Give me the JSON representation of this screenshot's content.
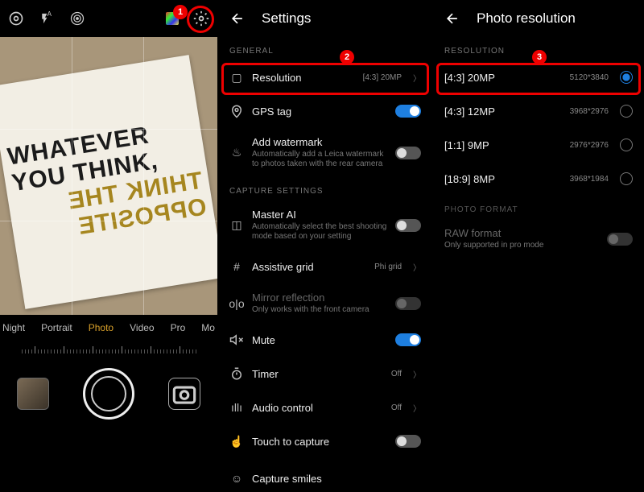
{
  "panel1": {
    "modes": [
      "Night",
      "Portrait",
      "Photo",
      "Video",
      "Pro",
      "Mo"
    ],
    "active_mode_index": 2,
    "poster_lines": [
      "WHATEVER",
      "YOU THINK,",
      "THINK THE",
      "OPPOSITE"
    ]
  },
  "panel2": {
    "title": "Settings",
    "sections": {
      "general": {
        "label": "GENERAL",
        "resolution": {
          "label": "Resolution",
          "value": "[4:3] 20MP"
        },
        "gps": {
          "label": "GPS tag",
          "on": true
        },
        "watermark": {
          "label": "Add watermark",
          "sub": "Automatically add a Leica watermark to photos taken with the rear camera",
          "on": false
        }
      },
      "capture": {
        "label": "CAPTURE SETTINGS",
        "masterai": {
          "label": "Master AI",
          "sub": "Automatically select the best shooting mode based on your setting",
          "on": false
        },
        "grid": {
          "label": "Assistive grid",
          "value": "Phi grid"
        },
        "mirror": {
          "label": "Mirror reflection",
          "sub": "Only works with the front camera",
          "on": false
        },
        "mute": {
          "label": "Mute",
          "on": true
        },
        "timer": {
          "label": "Timer",
          "value": "Off"
        },
        "audio": {
          "label": "Audio control",
          "value": "Off"
        },
        "touch": {
          "label": "Touch to capture",
          "on": false
        },
        "smiles": {
          "label": "Capture smiles"
        }
      }
    }
  },
  "panel3": {
    "title": "Photo resolution",
    "resolution_label": "RESOLUTION",
    "options": [
      {
        "label": "[4:3] 20MP",
        "dims": "5120*3840",
        "selected": true
      },
      {
        "label": "[4:3] 12MP",
        "dims": "3968*2976",
        "selected": false
      },
      {
        "label": "[1:1] 9MP",
        "dims": "2976*2976",
        "selected": false
      },
      {
        "label": "[18:9] 8MP",
        "dims": "3968*1984",
        "selected": false
      }
    ],
    "format_label": "PHOTO FORMAT",
    "raw": {
      "label": "RAW format",
      "sub": "Only supported in pro mode"
    }
  },
  "callouts": {
    "one": "1",
    "two": "2",
    "three": "3"
  }
}
